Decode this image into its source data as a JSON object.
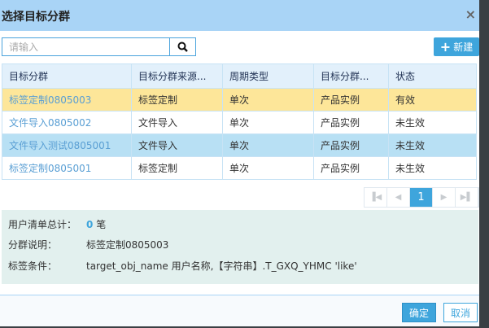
{
  "dialog": {
    "title": "选择目标分群",
    "close_icon": "×"
  },
  "search": {
    "placeholder": "请输入",
    "value": ""
  },
  "toolbar": {
    "new_label": "新建"
  },
  "table": {
    "headers": [
      "目标分群",
      "目标分群来源...",
      "周期类型",
      "目标分群...",
      "状态"
    ],
    "rows": [
      [
        "标签定制0805003",
        "标签定制",
        "单次",
        "产品实例",
        "有效"
      ],
      [
        "文件导入0805002",
        "文件导入",
        "单次",
        "产品实例",
        "未生效"
      ],
      [
        "文件导入测试0805001",
        "文件导入",
        "单次",
        "产品实例",
        "未生效"
      ],
      [
        "标签定制0805001",
        "标签定制",
        "单次",
        "产品实例",
        "未生效"
      ]
    ]
  },
  "pagination": {
    "current": "1"
  },
  "info": {
    "total_label": "用户清单总计：",
    "total_count": "0",
    "total_unit": "笔",
    "desc_label": "分群说明：",
    "desc_value": "标签定制0805003",
    "cond_label": "标签条件：",
    "cond_value": "target_obj_name 用户名称,【字符串】.T_GXQ_YHMC 'like'"
  },
  "footer": {
    "ok_label": "确定",
    "cancel_label": "取消"
  }
}
